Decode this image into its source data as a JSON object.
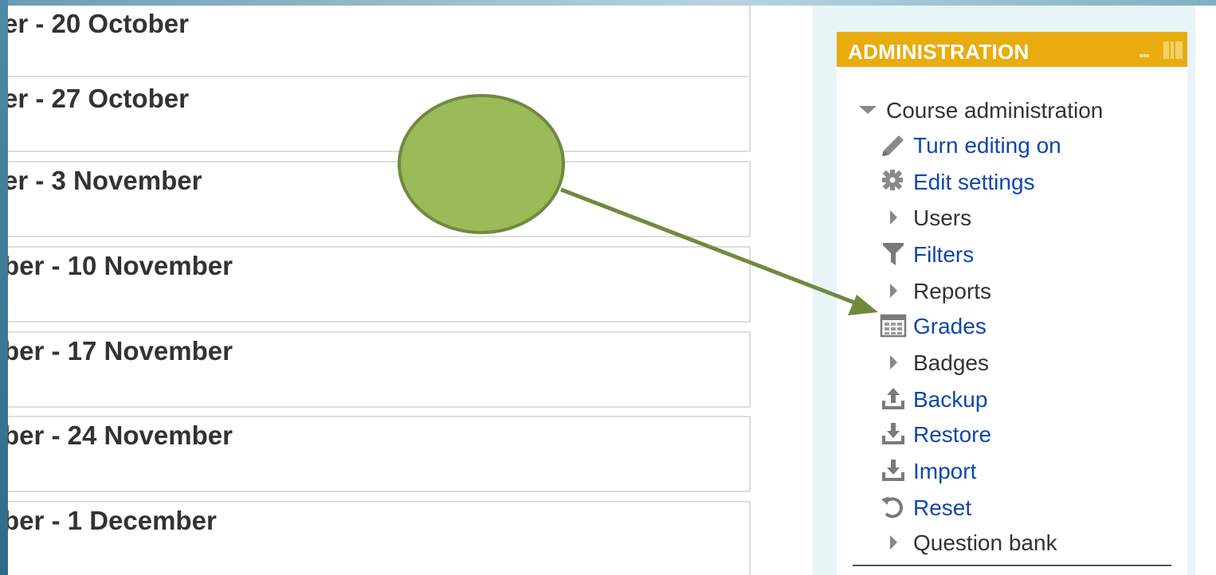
{
  "sections": [
    {
      "title": "er - 20 October"
    },
    {
      "title": "er - 27 October"
    },
    {
      "title": "er - 3 November"
    },
    {
      "title": "ber - 10 November"
    },
    {
      "title": "ber - 17 November"
    },
    {
      "title": "ber - 24 November"
    },
    {
      "title": "ber - 1 December"
    }
  ],
  "administration": {
    "title": "ADMINISTRATION",
    "course_admin_label": "Course administration",
    "items": [
      {
        "label": "Turn editing on",
        "icon": "pencil-icon"
      },
      {
        "label": "Edit settings",
        "icon": "gear-icon"
      },
      {
        "label": "Users",
        "icon": "triangle-right-icon"
      },
      {
        "label": "Filters",
        "icon": "filter-icon"
      },
      {
        "label": "Reports",
        "icon": "triangle-right-icon"
      },
      {
        "label": "Grades",
        "icon": "grades-table-icon"
      },
      {
        "label": "Badges",
        "icon": "triangle-right-icon"
      },
      {
        "label": "Backup",
        "icon": "upload-tray-icon"
      },
      {
        "label": "Restore",
        "icon": "download-tray-icon"
      },
      {
        "label": "Import",
        "icon": "download-tray-icon"
      },
      {
        "label": "Reset",
        "icon": "reset-icon"
      },
      {
        "label": "Question bank",
        "icon": "triangle-right-icon"
      }
    ]
  },
  "colors": {
    "header_bg": "#e8ac0f",
    "link": "#0f47ad",
    "annotation_fill": "#9bbb59",
    "annotation_stroke": "#71893f"
  }
}
